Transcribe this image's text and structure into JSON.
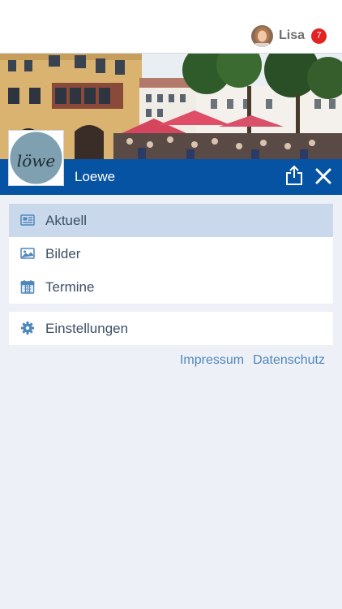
{
  "header": {
    "user": {
      "name": "Lisa",
      "notification_count": "7"
    }
  },
  "group": {
    "name": "Loewe",
    "logo_text": "löwe"
  },
  "menu": {
    "items": [
      {
        "label": "Aktuell",
        "icon": "newspaper-icon",
        "active": true
      },
      {
        "label": "Bilder",
        "icon": "image-icon",
        "active": false
      },
      {
        "label": "Termine",
        "icon": "calendar-icon",
        "active": false
      }
    ],
    "settings": {
      "label": "Einstellungen",
      "icon": "gear-icon"
    }
  },
  "footer": {
    "impressum": "Impressum",
    "datenschutz": "Datenschutz"
  },
  "colors": {
    "brand_blue": "#0753a3",
    "active_item": "#c9d9eb",
    "link": "#4f86bd",
    "badge": "#e02424",
    "background": "#edf1f7"
  }
}
